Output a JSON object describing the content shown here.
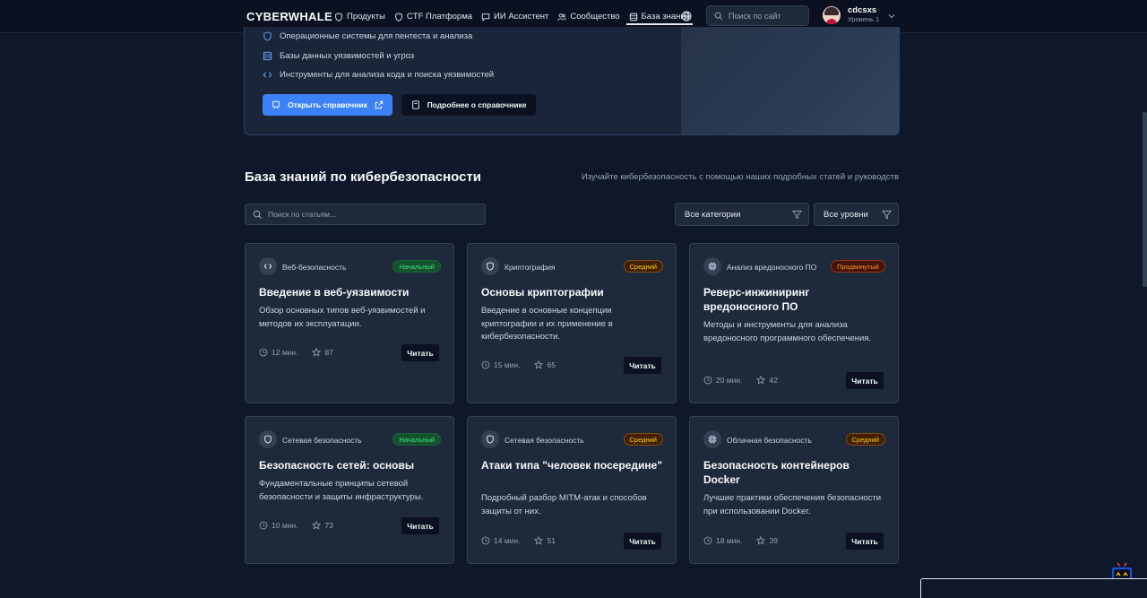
{
  "header": {
    "logo": "CYBERWHALE",
    "nav": [
      "Продукты",
      "CTF Платформа",
      "ИИ Ассистент",
      "Сообщество",
      "База знаний"
    ],
    "active_nav": "База знаний",
    "search_placeholder": "Поиск по сайт",
    "user_name": "cdcsxs",
    "user_level": "Уровень 1"
  },
  "promo": {
    "bullets": [
      "Операционные системы для пентеста и анализа",
      "Базы данных уязвимостей и угроз",
      "Инструменты для анализа кода и поиска уязвимостей"
    ],
    "open_button": "Открыть справочник",
    "more_button": "Подробнее о справочнике"
  },
  "section": {
    "title": "База знаний по кибербезопасности",
    "subtitle": "Изучайте кибербезопасность с помощью наших подробных статей и руководств",
    "search_placeholder": "Поиск по статьям...",
    "category_filter": "Все категории",
    "level_filter": "Все уровни"
  },
  "cards": [
    {
      "category": "Веб-безопасность",
      "icon": "code-icon",
      "level": "Начальный",
      "level_color": "green",
      "title": "Введение в веб-уязвимости",
      "desc": "Обзор основных типов веб-уязвимостей и методов их эксплуатации.",
      "time": "12 мин.",
      "rating": "87",
      "read": "Читать"
    },
    {
      "category": "Криптография",
      "icon": "shield-icon",
      "level": "Средний",
      "level_color": "yellow",
      "title": "Основы криптографии",
      "desc": "Введение в основные концепции криптографии и их применение в кибербезопасности.",
      "time": "15 мин.",
      "rating": "65",
      "read": "Читать"
    },
    {
      "category": "Анализ вредоносного ПО",
      "icon": "chip-icon",
      "level": "Продвинутый",
      "level_color": "orange",
      "title": "Реверс-инжиниринг вредоносного ПО",
      "desc": "Методы и инструменты для анализа вредоносного программного обеспечения.",
      "time": "20 мин.",
      "rating": "42",
      "read": "Читать"
    },
    {
      "category": "Сетевая безопасность",
      "icon": "shield-icon",
      "level": "Начальный",
      "level_color": "green",
      "title": "Безопасность сетей: основы",
      "desc": "Фундаментальные принципы сетевой безопасности и защиты инфраструктуры.",
      "time": "10 мин.",
      "rating": "73",
      "read": "Читать"
    },
    {
      "category": "Сетевая безопасность",
      "icon": "shield-icon",
      "level": "Средний",
      "level_color": "yellow",
      "title": "Атаки типа \"человек посередине\"",
      "desc": "Подробный разбор MITM-атак и способов защиты от них.",
      "time": "14 мин.",
      "rating": "51",
      "read": "Читать"
    },
    {
      "category": "Облачная безопасность",
      "icon": "chip-icon",
      "level": "Средний",
      "level_color": "yellow",
      "title": "Безопасность контейнеров Docker",
      "desc": "Лучшие практики обеспечения безопасности при использовании Docker.",
      "time": "18 мин.",
      "rating": "39",
      "read": "Читать"
    }
  ]
}
